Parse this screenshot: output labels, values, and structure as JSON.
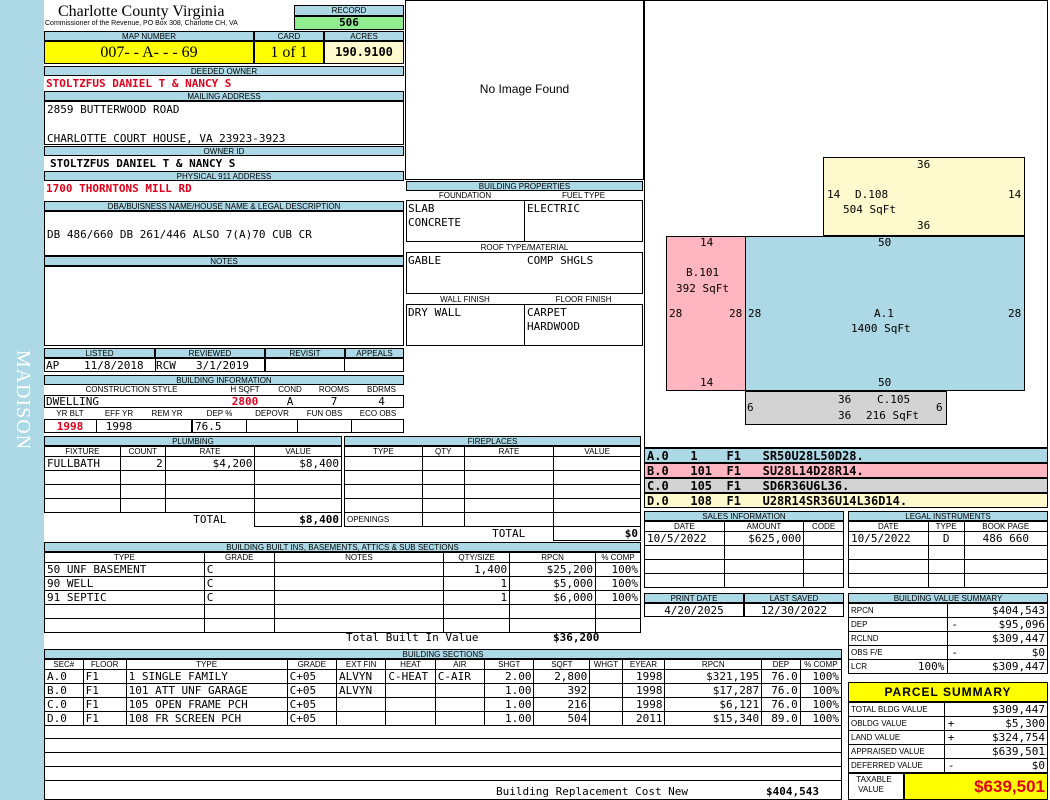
{
  "side_label": "MADISON",
  "header": {
    "county": "Charlotte County Virginia",
    "office": "Commissioner of the Revenue, PO Box 308, Charlotte CH, VA",
    "record_label": "RECORD",
    "record": "506",
    "map_label": "MAP NUMBER",
    "map": "007- - A- - - 69",
    "card_label": "CARD",
    "card": "1 of 1",
    "acres_label": "ACRES",
    "acres": "190.9100"
  },
  "owner": {
    "deeded_label": "DEEDED OWNER",
    "deeded": "STOLTZFUS DANIEL T & NANCY S",
    "mailing_label": "MAILING ADDRESS",
    "mail1": "2859 BUTTERWOOD ROAD",
    "mail2": "CHARLOTTE COURT HOUSE, VA 23923-3923",
    "id_label": "OWNER ID",
    "owner_id": "STOLTZFUS DANIEL T & NANCY S",
    "addr_label": "PHYSICAL 911 ADDRESS",
    "addr": "1700 THORNTONS MILL RD",
    "dba_label": "DBA/BUISNESS NAME/HOUSE NAME & LEGAL DESCRIPTION",
    "dba": "DB 486/660 DB 261/446 ALSO 7(A)70 CUB CR",
    "notes_label": "NOTES"
  },
  "listing": {
    "listed_label": "LISTED",
    "reviewed_label": "REVIEWED",
    "revisit_label": "REVISIT",
    "appeals_label": "APPEALS",
    "listed_by": "AP",
    "listed_date": "11/8/2018",
    "reviewed_by": "RCW",
    "reviewed_date": "3/1/2019"
  },
  "bldg_info": {
    "title": "BUILDING INFORMATION",
    "style_label": "CONSTRUCTION STYLE",
    "hsqft_label": "H SQFT",
    "cond_label": "COND",
    "rooms_label": "ROOMS",
    "bdrms_label": "BDRMS",
    "style": "DWELLING",
    "hsqft": "2800",
    "cond": "A",
    "rooms": "7",
    "bdrms": "4",
    "yrblt_label": "YR BLT",
    "effyr_label": "EFF YR",
    "remyr_label": "REM YR",
    "dep_label": "DEP %",
    "depovr_label": "DEPOVR",
    "funobs_label": "FUN OBS",
    "ecoobs_label": "ECO OBS",
    "yrblt": "1998",
    "effyr": "1998",
    "dep": "76.5"
  },
  "image_text": "No Image Found",
  "bldg_props": {
    "title": "BUILDING PROPERTIES",
    "foundation_label": "FOUNDATION",
    "fuel_label": "FUEL TYPE",
    "foundation1": "SLAB",
    "foundation2": "CONCRETE",
    "fuel": "ELECTRIC",
    "roof_label": "ROOF TYPE/MATERIAL",
    "roof1": "GABLE",
    "roof2": "COMP SHGLS",
    "wall_label": "WALL FINISH",
    "floor_label": "FLOOR FINISH",
    "wall": "DRY WALL",
    "floor1": "CARPET",
    "floor2": "HARDWOOD"
  },
  "sketch": {
    "a_label": "A.1",
    "a_area": "1400 SqFt",
    "a_top": "50",
    "a_bottom": "50",
    "a_left": "28",
    "a_right": "28",
    "b_label": "B.101",
    "b_area": "392 SqFt",
    "b_top": "14",
    "b_bottom": "14",
    "b_left": "28",
    "b_right": "28",
    "c_label": "C.105",
    "c_area": "216 SqFt",
    "c_top": "36",
    "c_bottom": "36",
    "c_left": "6",
    "c_right": "6",
    "d_label": "D.108",
    "d_area": "504 SqFt",
    "d_top": "36",
    "d_bottom": "36",
    "d_left": "14",
    "d_right": "14"
  },
  "sketch_lines": [
    {
      "text": "A.0   1    F1   SR50U28L50D28.",
      "color": "#add8e6"
    },
    {
      "text": "B.0   101  F1   SU28L14D28R14.",
      "color": "#ffb6c1"
    },
    {
      "text": "C.0   105  F1   SD6R36U6L36.",
      "color": "#d3d3d3"
    },
    {
      "text": "D.0   108  F1   U28R14SR36U14L36D14.",
      "color": "#fffacd"
    }
  ],
  "plumbing": {
    "title": "PLUMBING",
    "fixture_label": "FIXTURE",
    "count_label": "COUNT",
    "rate_label": "RATE",
    "value_label": "VALUE",
    "fixture": "FULLBATH",
    "count": "2",
    "rate": "$4,200",
    "value": "$8,400",
    "total_label": "TOTAL",
    "total": "$8,400"
  },
  "fireplaces": {
    "title": "FIREPLACES",
    "type_label": "TYPE",
    "qty_label": "QTY",
    "rate_label": "RATE",
    "value_label": "VALUE",
    "openings_label": "OPENINGS",
    "total_label": "TOTAL",
    "total": "$0"
  },
  "sales": {
    "title": "SALES INFORMATION",
    "date_label": "DATE",
    "amount_label": "AMOUNT",
    "code_label": "CODE",
    "date": "10/5/2022",
    "amount": "$625,000"
  },
  "legal": {
    "title": "LEGAL INSTRUMENTS",
    "date_label": "DATE",
    "type_label": "TYPE",
    "book_label": "BOOK PAGE",
    "date": "10/5/2022",
    "type": "D",
    "book": "486 660"
  },
  "print": {
    "print_label": "PRINT DATE",
    "saved_label": "LAST SAVED",
    "print_date": "4/20/2025",
    "saved_date": "12/30/2022"
  },
  "builtins": {
    "title": "BUILDING BUILT INS, BASEMENTS, ATTICS & SUB SECTIONS",
    "type_label": "TYPE",
    "grade_label": "GRADE",
    "notes_label": "NOTES",
    "qty_label": "QTY/SIZE",
    "rpcn_label": "RPCN",
    "comp_label": "% COMP",
    "rows": [
      [
        "50 UNF BASEMENT",
        "C",
        "",
        "1,400",
        "$25,200",
        "100%"
      ],
      [
        "90 WELL",
        "C",
        "",
        "1",
        "$5,000",
        "100%"
      ],
      [
        "91 SEPTIC",
        "C",
        "",
        "1",
        "$6,000",
        "100%"
      ]
    ],
    "total_label": "Total Built In Value",
    "total": "$36,200"
  },
  "value_summary": {
    "title": "BUILDING VALUE SUMMARY",
    "rpcn_label": "RPCN",
    "rpcn": "$404,543",
    "dep_label": "DEP",
    "dep_sign": "-",
    "dep": "$95,096",
    "rclnd_label": "RCLND",
    "rclnd": "$309,447",
    "obs_label": "OBS F/E",
    "obs_sign": "-",
    "obs": "$0",
    "lcr_label": "LCR",
    "lcr_pct": "100%",
    "lcr": "$309,447"
  },
  "sections": {
    "title": "BUILDING SECTIONS",
    "headers": [
      "SEC#",
      "FLOOR",
      "TYPE",
      "GRADE",
      "EXT FIN",
      "HEAT",
      "AIR",
      "SHGT",
      "SQFT",
      "WHGT",
      "EYEAR",
      "RPCN",
      "DEP",
      "% COMP"
    ],
    "rows": [
      [
        "A.0",
        "F1",
        "1 SINGLE FAMILY",
        "C+05",
        "ALVYN",
        "C-HEAT",
        "C-AIR",
        "2.00",
        "2,800",
        "",
        "1998",
        "$321,195",
        "76.0",
        "100%"
      ],
      [
        "B.0",
        "F1",
        "101 ATT UNF GARAGE",
        "C+05",
        "ALVYN",
        "",
        "",
        "1.00",
        "392",
        "",
        "1998",
        "$17,287",
        "76.0",
        "100%"
      ],
      [
        "C.0",
        "F1",
        "105 OPEN FRAME PCH",
        "C+05",
        "",
        "",
        "",
        "1.00",
        "216",
        "",
        "1998",
        "$6,121",
        "76.0",
        "100%"
      ],
      [
        "D.0",
        "F1",
        "108 FR SCREEN PCH",
        "C+05",
        "",
        "",
        "",
        "1.00",
        "504",
        "",
        "2011",
        "$15,340",
        "89.0",
        "100%"
      ]
    ],
    "total_label": "Building Replacement Cost New",
    "total": "$404,543"
  },
  "parcel": {
    "title": "PARCEL SUMMARY",
    "bldg_label": "TOTAL BLDG VALUE",
    "bldg": "$309,447",
    "obldg_label": "OBLDG VALUE",
    "obldg_sign": "+",
    "obldg": "$5,300",
    "land_label": "LAND VALUE",
    "land_sign": "+",
    "land": "$324,754",
    "appraised_label": "APPRAISED VALUE",
    "appraised": "$639,501",
    "deferred_label": "DEFERRED VALUE",
    "deferred_sign": "-",
    "deferred": "$0",
    "taxable_label1": "TAXABLE",
    "taxable_label2": "VALUE",
    "taxable": "$639,501"
  }
}
